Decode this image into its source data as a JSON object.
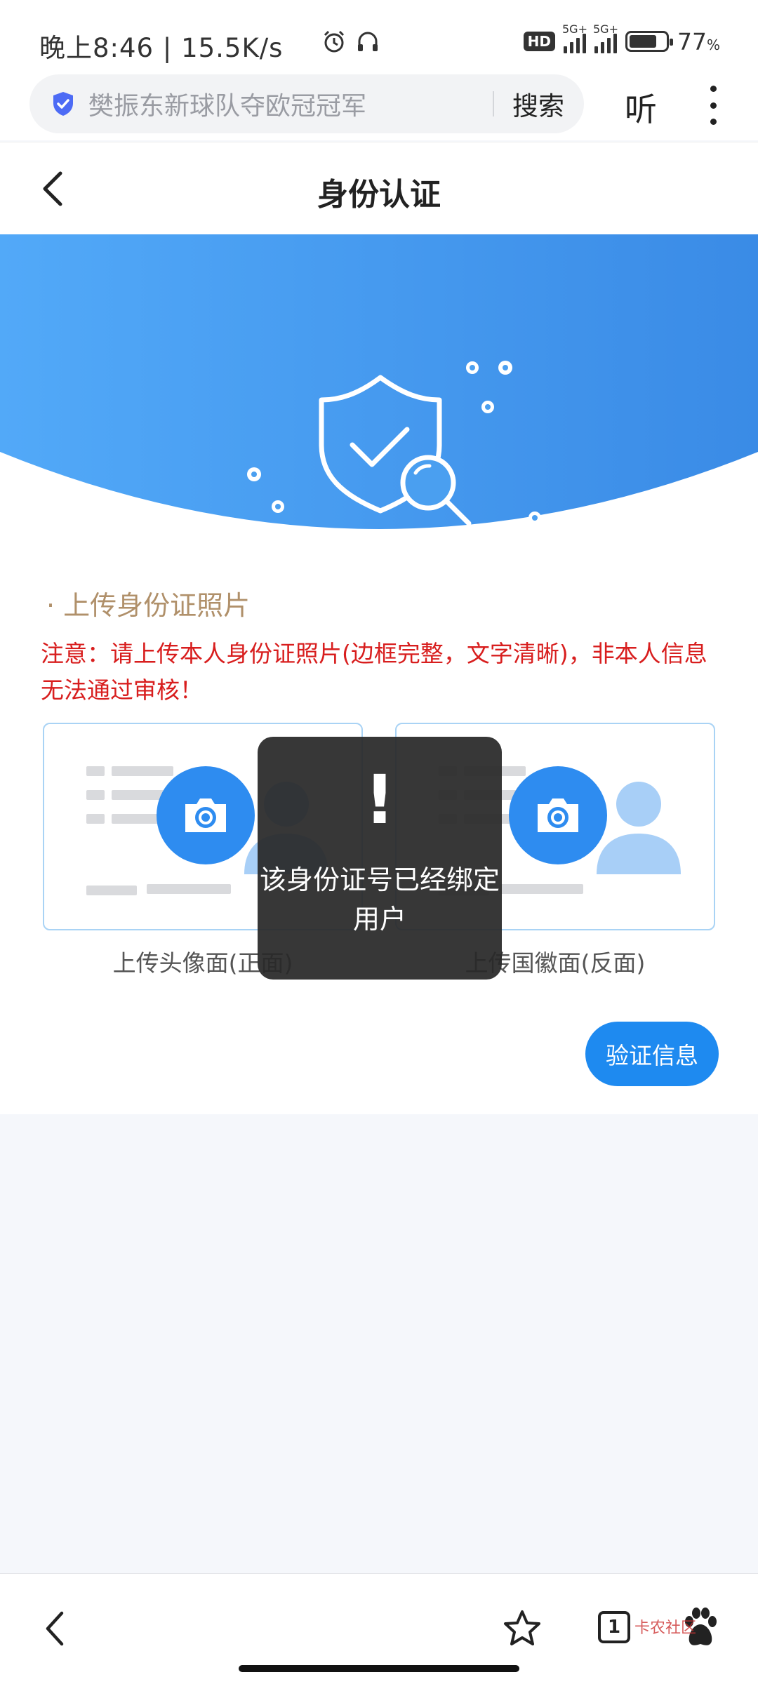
{
  "status": {
    "time": "晚上8:46 | 15.5K/s",
    "hd_label": "HD",
    "signal1_label": "5G+",
    "signal2_label": "5G+",
    "battery_pct": "77",
    "battery_unit": "%",
    "icons": [
      "alarm-icon",
      "headset-icon",
      "battery-icon"
    ]
  },
  "browser": {
    "search_text": "樊振东新球队夺欧冠冠军",
    "search_button": "搜索",
    "listen_button": "听"
  },
  "page": {
    "title": "身份认证"
  },
  "upload": {
    "section_title": "· 上传身份证照片",
    "notice": "注意：请上传本人身份证照片(边框完整，文字清晰)，非本人信息无法通过审核！",
    "front_label": "上传头像面(正面)",
    "back_label": "上传国徽面(反面)",
    "verify_button": "验证信息"
  },
  "toast": {
    "icon": "!",
    "message": "该身份证号已经绑定用户"
  },
  "bottom_nav": {
    "tab_count": "1",
    "watermark": "卡农社区"
  },
  "colors": {
    "accent": "#1e8af0",
    "hero_blue": "#3a93ec",
    "notice_red": "#d81e1e",
    "section_gold": "#b0906a"
  }
}
